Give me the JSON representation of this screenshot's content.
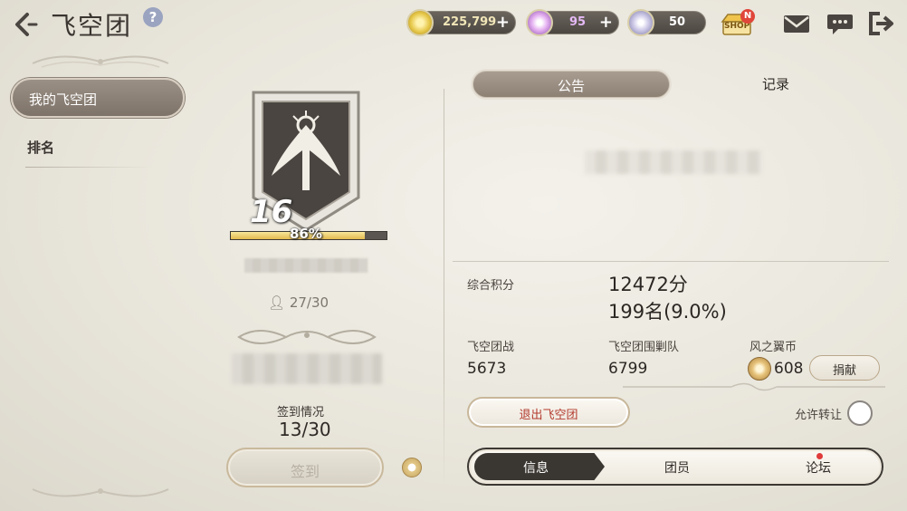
{
  "header": {
    "title": "飞空团",
    "help_label": "?",
    "currencies": [
      {
        "name": "gold",
        "value": "225,799",
        "plus": "+",
        "color": "#e6c84a"
      },
      {
        "name": "gem",
        "value": "95",
        "plus": "+",
        "color": "#c98de6"
      },
      {
        "name": "crystal",
        "value": "50",
        "color": "#b8b4d8"
      }
    ],
    "shop_label": "SHOP",
    "shop_badge": "N"
  },
  "sidebar": {
    "items": [
      {
        "label": "我的飞空团",
        "active": true
      },
      {
        "label": "排名",
        "active": false
      }
    ]
  },
  "guild": {
    "level": "16",
    "progress_text": "86%",
    "progress": 0.86,
    "members": "27/30",
    "signin_label": "签到情况",
    "signin_count": "13/30",
    "signin_button": "签到"
  },
  "panel": {
    "tabs": [
      {
        "label": "公告",
        "active": true
      },
      {
        "label": "记录",
        "active": false
      }
    ],
    "score_label": "综合积分",
    "score_value": "12472分",
    "rank_value": "199名(9.0%)",
    "stats": [
      {
        "label": "飞空团战",
        "value": "5673"
      },
      {
        "label": "飞空团围剿队",
        "value": "6799"
      },
      {
        "label": "风之翼币",
        "value": "608"
      }
    ],
    "donate_button": "捐献",
    "leave_button": "退出飞空团",
    "transfer_label": "允许转让"
  },
  "bottom_tabs": [
    {
      "label": "信息",
      "active": true
    },
    {
      "label": "团员",
      "active": false
    },
    {
      "label": "论坛",
      "active": false,
      "notification": true
    }
  ]
}
